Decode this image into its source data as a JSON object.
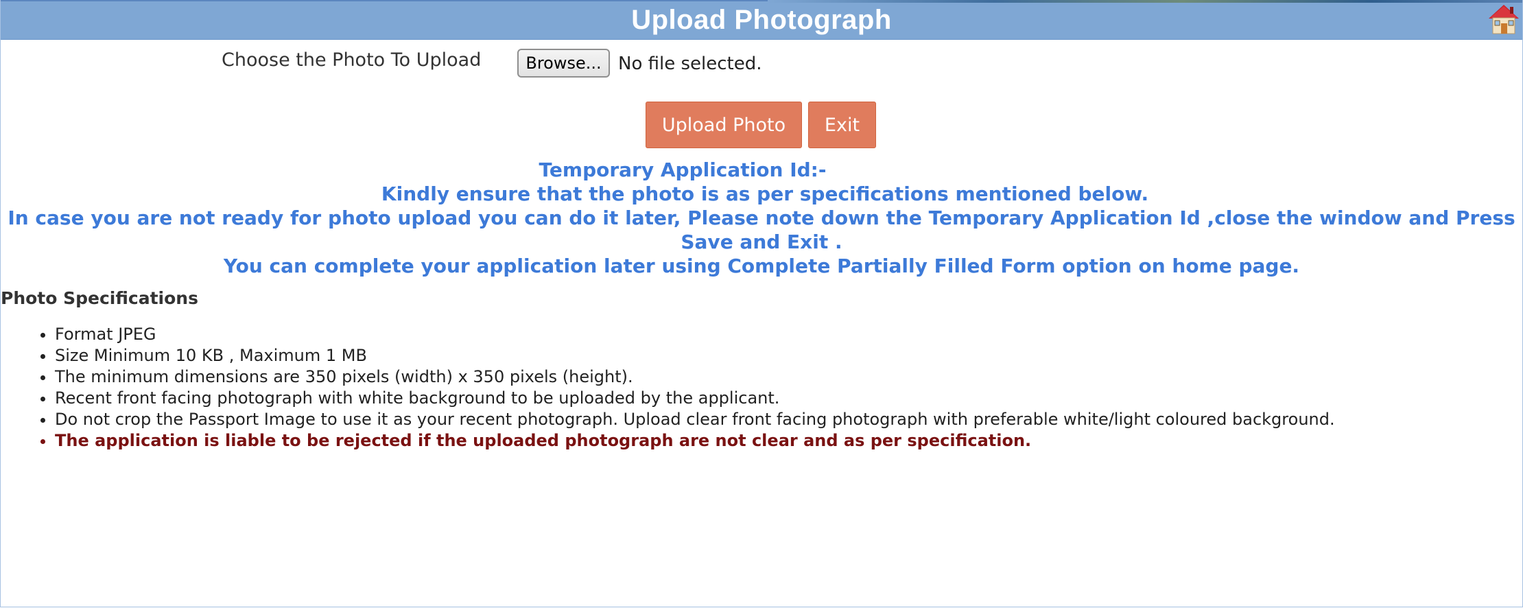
{
  "header": {
    "title": "Upload Photograph",
    "home_icon": "home-icon"
  },
  "upload": {
    "label": "Choose the Photo To Upload",
    "browse_label": "Browse...",
    "file_status": "No file selected."
  },
  "actions": {
    "upload_label": "Upload Photo",
    "exit_label": "Exit"
  },
  "notice": {
    "temp_id_label": "Temporary Application Id:-",
    "ensure_text": "Kindly ensure that the photo is as per specifications mentioned below.",
    "later_text": "In case you are not ready for photo upload you can do it later, Please note down the Temporary Application Id ,close the window and Press Save and Exit .",
    "complete_text": "You can complete your application later using Complete Partially Filled Form option on home page."
  },
  "specs": {
    "title": "Photo Specifications",
    "items": [
      "Format  JPEG",
      "Size  Minimum 10 KB , Maximum 1 MB",
      "The minimum dimensions are 350 pixels (width) x 350 pixels (height).",
      "Recent front facing photograph with white background to be uploaded by the applicant.",
      "Do not crop the Passport Image to use it as your recent photograph. Upload clear front facing photograph with preferable white/light coloured background.",
      "The application is liable to be rejected if the uploaded photograph are not clear and as per specification."
    ]
  },
  "colors": {
    "header_bg": "#7fa7d4",
    "button_bg": "#e07c5d",
    "notice_text": "#3d7ad8",
    "warning_text": "#7a1212"
  }
}
